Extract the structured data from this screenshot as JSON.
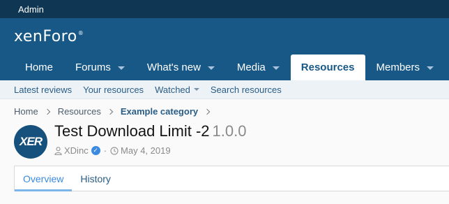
{
  "admin_bar": {
    "label": "Admin"
  },
  "header": {
    "logo_text": "xenForo",
    "logo_mark": "®"
  },
  "nav": {
    "tabs": [
      {
        "label": "Home",
        "has_dropdown": false
      },
      {
        "label": "Forums",
        "has_dropdown": true
      },
      {
        "label": "What's new",
        "has_dropdown": true
      },
      {
        "label": "Media",
        "has_dropdown": true
      },
      {
        "label": "Resources",
        "has_dropdown": false,
        "active": true
      },
      {
        "label": "Members",
        "has_dropdown": true
      }
    ]
  },
  "subnav": {
    "items": [
      {
        "label": "Latest reviews"
      },
      {
        "label": "Your resources"
      },
      {
        "label": "Watched",
        "has_dropdown": true
      },
      {
        "label": "Search resources"
      }
    ]
  },
  "breadcrumb": {
    "items": [
      "Home",
      "Resources",
      "Example category"
    ]
  },
  "resource": {
    "avatar_text": "XER",
    "title": "Test Download Limit -2",
    "version": "1.0.0",
    "author": "XDinc",
    "date": "May 4, 2019"
  },
  "tabs": {
    "items": [
      {
        "label": "Overview",
        "active": true
      },
      {
        "label": "History",
        "active": false
      }
    ]
  },
  "colors": {
    "admin_bar": "#0f3652",
    "header": "#185886",
    "subnav": "#edf2f7",
    "link": "#2a5d85",
    "accent": "#3b8ae0"
  }
}
